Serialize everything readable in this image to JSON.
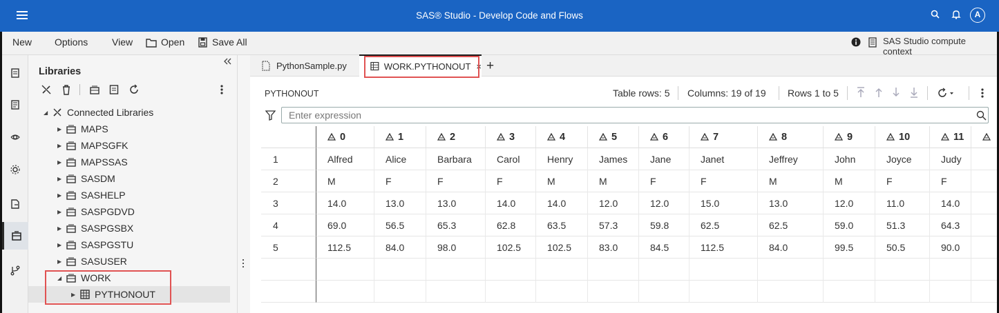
{
  "app": {
    "title": "SAS® Studio - Develop Code and Flows",
    "user_initial": "A"
  },
  "menubar": {
    "new": "New",
    "options": "Options",
    "view": "View",
    "open": "Open",
    "save_all": "Save All",
    "context": "SAS Studio compute context"
  },
  "libraries": {
    "title": "Libraries",
    "root": "Connected Libraries",
    "items": [
      "MAPS",
      "MAPSGFK",
      "MAPSSAS",
      "SASDM",
      "SASHELP",
      "SASPGDVD",
      "SASPGSBX",
      "SASPGSTU",
      "SASUSER",
      "WORK"
    ],
    "work_child": "PYTHONOUT"
  },
  "tabs": [
    {
      "label": "PythonSample.py"
    },
    {
      "label": "WORK.PYTHONOUT",
      "close": "×"
    }
  ],
  "tab_add": "+",
  "table": {
    "name": "PYTHONOUT",
    "rows_info": "Table rows: 5",
    "cols_info": "Columns: 19 of 19",
    "range_info": "Rows 1 to 5",
    "filter_placeholder": "Enter expression",
    "columns": [
      "0",
      "1",
      "2",
      "3",
      "4",
      "5",
      "6",
      "7",
      "8",
      "9",
      "10",
      "11"
    ],
    "row_numbers": [
      "1",
      "2",
      "3",
      "4",
      "5"
    ],
    "rows": [
      [
        "Alfred",
        "Alice",
        "Barbara",
        "Carol",
        "Henry",
        "James",
        "Jane",
        "Janet",
        "Jeffrey",
        "John",
        "Joyce",
        "Judy"
      ],
      [
        "M",
        "F",
        "F",
        "F",
        "M",
        "M",
        "F",
        "F",
        "M",
        "M",
        "F",
        "F"
      ],
      [
        "14.0",
        "13.0",
        "13.0",
        "14.0",
        "14.0",
        "12.0",
        "12.0",
        "15.0",
        "13.0",
        "12.0",
        "11.0",
        "14.0"
      ],
      [
        "69.0",
        "56.5",
        "65.3",
        "62.8",
        "63.5",
        "57.3",
        "59.8",
        "62.5",
        "62.5",
        "59.0",
        "51.3",
        "64.3"
      ],
      [
        "112.5",
        "84.0",
        "98.0",
        "102.5",
        "102.5",
        "83.0",
        "84.5",
        "112.5",
        "84.0",
        "99.5",
        "50.5",
        "90.0"
      ]
    ]
  },
  "colors": {
    "topbar": "#1a64c3",
    "highlight": "#e05252"
  }
}
